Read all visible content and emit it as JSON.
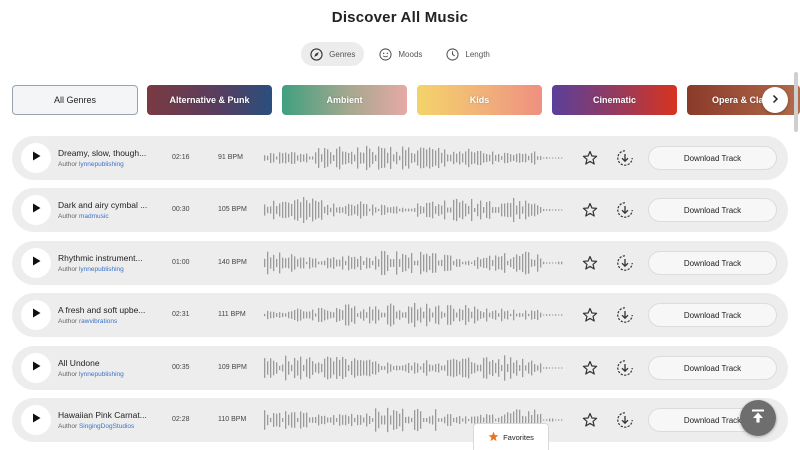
{
  "page": {
    "title": "Discover All Music"
  },
  "filter_tabs": [
    {
      "label": "Genres",
      "icon": "compass-icon",
      "active": true
    },
    {
      "label": "Moods",
      "icon": "smiley-icon",
      "active": false
    },
    {
      "label": "Length",
      "icon": "clock-icon",
      "active": false
    }
  ],
  "genres": [
    {
      "label": "All Genres",
      "selected": true
    },
    {
      "label": "Alternative & Punk",
      "colors": [
        "#7a3a42",
        "#2a4f7e"
      ]
    },
    {
      "label": "Ambient",
      "colors": [
        "#3fa080",
        "#e6a9a5"
      ]
    },
    {
      "label": "Kids",
      "colors": [
        "#f4d36a",
        "#ef8f80"
      ]
    },
    {
      "label": "Cinematic",
      "colors": [
        "#5a3f9a",
        "#d8331f"
      ]
    },
    {
      "label": "Opera & Cla",
      "colors": [
        "#8a3a2a",
        "#b26b4a"
      ]
    }
  ],
  "track_common": {
    "author_prefix": "Author",
    "download_label": "Download Track",
    "play_icon": "play-icon",
    "favorite_icon": "star-icon",
    "download_icon": "download-circle-icon"
  },
  "tracks": [
    {
      "title": "Dreamy, slow, though...",
      "author": "lynnepublishing",
      "duration": "02:16",
      "bpm": "91 BPM"
    },
    {
      "title": "Dark and airy cymbal ...",
      "author": "madmusic",
      "duration": "00:30",
      "bpm": "105 BPM"
    },
    {
      "title": "Rhythmic instrument...",
      "author": "lynnepublishing",
      "duration": "01:00",
      "bpm": "140 BPM"
    },
    {
      "title": "A fresh and soft upbe...",
      "author": "rawvibrations",
      "duration": "02:31",
      "bpm": "111 BPM"
    },
    {
      "title": "All Undone",
      "author": "lynnepublishing",
      "duration": "00:35",
      "bpm": "109 BPM"
    },
    {
      "title": "Hawaiian Pink Carnat...",
      "author": "SingingDogStudios",
      "duration": "02:28",
      "bpm": "110 BPM"
    }
  ],
  "favorites": {
    "label": "Favorites",
    "icon": "star-filled-icon",
    "color": "#e8731a"
  },
  "scroll_top": {
    "icon": "arrow-up-to-top-icon"
  },
  "colors": {
    "track_bg": "#ededed",
    "author_link": "#3a73c8",
    "waveform": "#9a9a9a"
  }
}
